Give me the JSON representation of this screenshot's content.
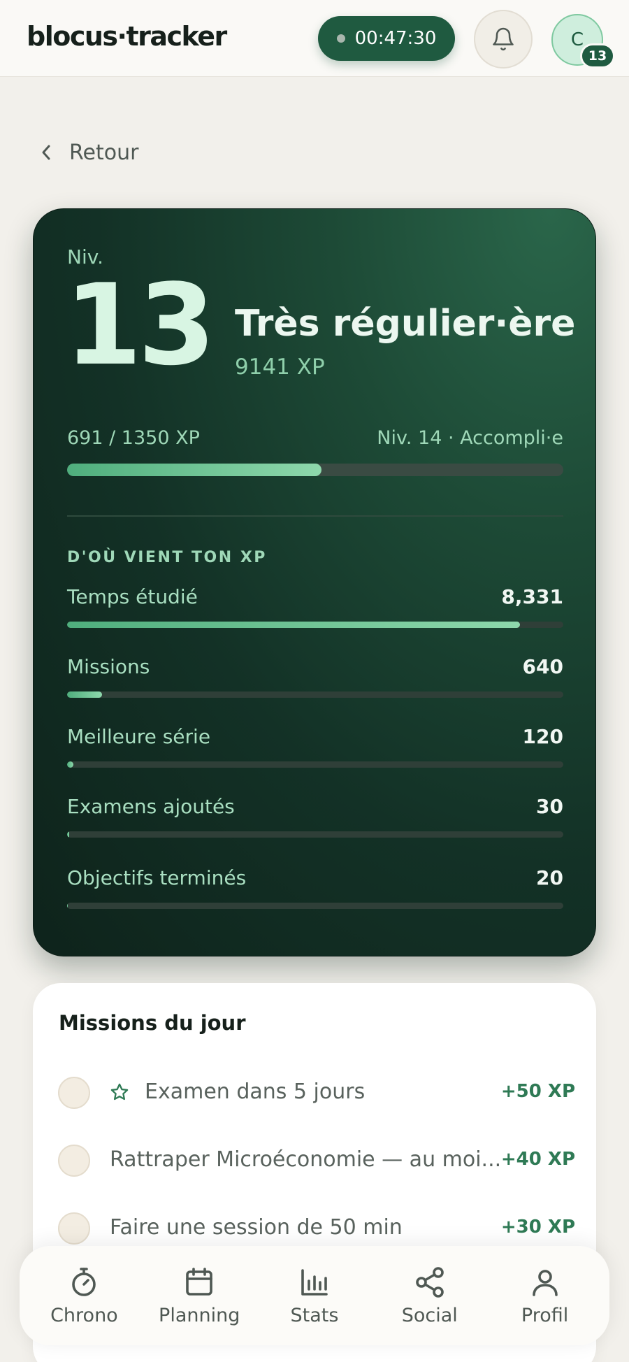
{
  "header": {
    "logo": "blocus·tracker",
    "timer": "00:47:30",
    "avatar_initial": "C",
    "avatar_level": "13"
  },
  "back_label": "Retour",
  "level_card": {
    "niv_label": "Niv.",
    "level": "13",
    "rank_title": "Très régulier·ère",
    "total_xp": "9141 XP",
    "progress_label": "691 / 1350 XP",
    "next_level_label": "Niv. 14 · Accompli·e",
    "progress_fraction": 0.512,
    "section_title": "D'OÙ VIENT TON XP",
    "sources": [
      {
        "label": "Temps étudié",
        "value": "8,331",
        "fraction": 0.912
      },
      {
        "label": "Missions",
        "value": "640",
        "fraction": 0.07
      },
      {
        "label": "Meilleure série",
        "value": "120",
        "fraction": 0.013
      },
      {
        "label": "Examens ajoutés",
        "value": "30",
        "fraction": 0.004
      },
      {
        "label": "Objectifs terminés",
        "value": "20",
        "fraction": 0.002
      }
    ]
  },
  "missions": {
    "title": "Missions du jour",
    "items": [
      {
        "text": "Examen dans 5 jours",
        "xp": "+50 XP",
        "icon": "star-icon"
      },
      {
        "text": "Rattraper Microéconomie — au moi...",
        "xp": "+40 XP"
      },
      {
        "text": "Faire une session de 50 min",
        "xp": "+30 XP"
      }
    ]
  },
  "nav": {
    "items": [
      {
        "label": "Chrono",
        "icon": "stopwatch-icon"
      },
      {
        "label": "Planning",
        "icon": "calendar-icon"
      },
      {
        "label": "Stats",
        "icon": "bar-chart-icon"
      },
      {
        "label": "Social",
        "icon": "share-icon"
      },
      {
        "label": "Profil",
        "icon": "user-icon"
      }
    ]
  },
  "colors": {
    "accent": "#1f5a40",
    "card_bg": "#133126",
    "xp_green": "#2f7a55",
    "progress": "#6cc495"
  }
}
